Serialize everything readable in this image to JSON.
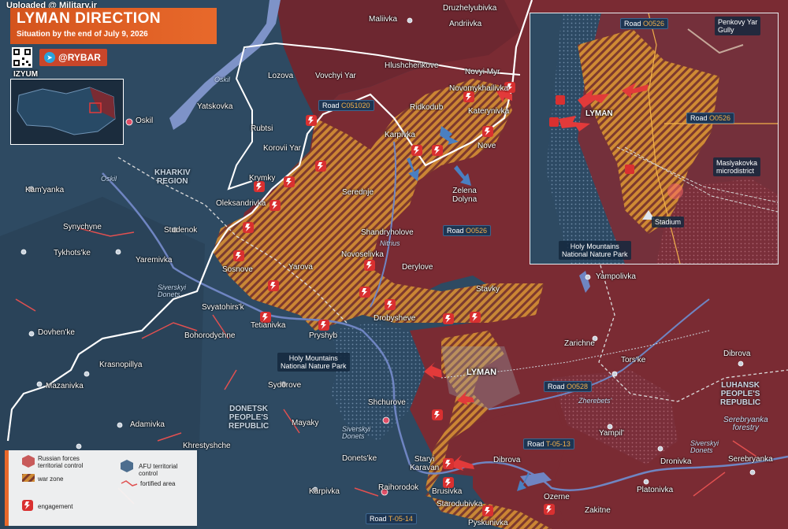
{
  "watermark": "Uploaded @ Military.ir",
  "title": "LYMAN DIRECTION",
  "subtitle": "Situation by the end of July 9, 2026",
  "brand": "@RYBAR",
  "colors": {
    "russian": "#7a2b33",
    "afu": "#2c4a63",
    "war_zone": "#d8892f",
    "fortified": "#e05050",
    "water": "#7e93c8",
    "front_line": "#ffffff"
  },
  "overview_map": {
    "label": "IZYUM"
  },
  "settlements": {
    "maliivka": "Maliivka",
    "druzhelyubivka": "Druzhelyubivka",
    "andriivka": "Andriivka",
    "oskil_river_top": "Oskil",
    "lozova": "Lozova",
    "vovchyi_yar": "Vovchyi Yar",
    "hlushchenkove": "Hlushchenkove",
    "novyi_myr": "Novyi Myr",
    "novomykhailivka": "Novomykhailivka",
    "yatskovka": "Yatskovka",
    "oskil_town": "Oskil",
    "rubtsi": "Rubtsi",
    "ridkodub": "Ridkodub",
    "katerynivka": "Katerynivka",
    "karpivka": "Karpivka",
    "nove": "Nove",
    "korovii_yar": "Korovii Yar",
    "krymky": "Krymky",
    "serednje": "Serednje",
    "zelena_dolyna": "Zelena\nDolyna",
    "kamyanka": "Kam'yanka",
    "oleksandrivka": "Oleksandrivka",
    "synychyne": "Synychyne",
    "studenok": "Studenok",
    "shandryholove": "Shandryholove",
    "tykhotske": "Tykhots'ke",
    "yaremivka": "Yaremivka",
    "novoselivka": "Novoselivka",
    "derylove": "Derylove",
    "sosnove": "Sosnove",
    "yarova": "Yarova",
    "stavky": "Stavky",
    "yampolivka": "Yampolivka",
    "svyatohirsk": "Svyatohirs'k",
    "drobysheve": "Drobysheve",
    "tetianivka": "Tetianivka",
    "pryshyb": "Pryshyb",
    "dovhenke": "Dovhen'ke",
    "bohorodychne": "Bohorodychne",
    "zarichne": "Zarichne",
    "lyman": "LYMAN",
    "torske": "Tors'ke",
    "dibrova_east": "Dibrova",
    "krasnopillya": "Krasnopillya",
    "mazanivka": "Mazanivka",
    "sydorove": "Sydorove",
    "shchurove": "Shchurove",
    "adamivka": "Adamivka",
    "mayaky": "Mayaky",
    "yampil": "Yampil'",
    "khrestyshche": "Khrestyshche",
    "donetske": "Donets'ke",
    "staryi_karavan": "Staryi\nKaravan",
    "dibrova_south": "Dibrova",
    "dronivka": "Dronivka",
    "serebryanka": "Serebryanka",
    "raihorodok": "Raihorodok",
    "brusivka": "Brusivka",
    "starodubivka": "Starodubivka",
    "ozerne": "Ozerne",
    "platonivka": "Platonivka",
    "zakitne": "Zakitne",
    "karpivka_south": "Karpivka",
    "pyskunivka": "Pyskunivka"
  },
  "regions": {
    "kharkiv": "KHARKIV\nREGION",
    "donetsk": "DONETSK\nPEOPLE'S\nREPUBLIC",
    "luhansk": "LUHANSK\nPEOPLE'S\nREPUBLIC",
    "holy_mountains": "Holy Mountains\nNational Nature Park",
    "serebryanka_forestry": "Serebryanka\nforestry"
  },
  "rivers": {
    "oskil_west": "Oskil",
    "siverskyi_donets_1": "Siverskyi\nDonets",
    "nitrius": "Nitrius",
    "siverskyi_donets_2": "Siverskyi\nDonets",
    "zherebets": "Zherebets'",
    "siverskyi_donets_3": "Siverskyi\nDonets"
  },
  "roads": {
    "c051020": {
      "prefix": "Road",
      "code": "C051020"
    },
    "o0526": {
      "prefix": "Road",
      "code": "O0526"
    },
    "o0528": {
      "prefix": "Road",
      "code": "O0528"
    },
    "t0513": {
      "prefix": "Road",
      "code": "T-05-13"
    },
    "t0514": {
      "prefix": "Road",
      "code": "T-05-14"
    }
  },
  "inset": {
    "road_top": {
      "prefix": "Road",
      "code": "O0526"
    },
    "road_right": {
      "prefix": "Road",
      "code": "O0526"
    },
    "penkovy_yar": "Penkovy Yar\nGully",
    "lyman": "LYMAN",
    "maslyakovka": "Maslyakovka\nmicrodistrict",
    "stadium": "Stadium",
    "holy_mountains": "Holy Mountains\nNational Nature Park"
  },
  "legend": {
    "russian": "Russian forces\nterritorial control",
    "afu": "AFU territorial control",
    "war_zone": "war zone",
    "fortified": "fortified area",
    "engagement": "engagement"
  }
}
